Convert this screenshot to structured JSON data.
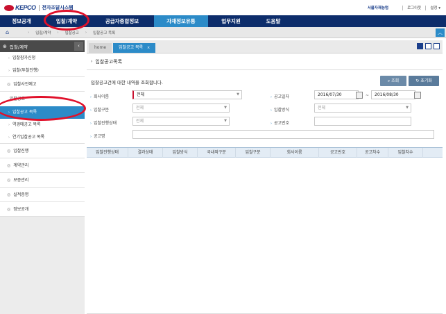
{
  "header": {
    "logo_brand": "KEPCO",
    "logo_system": "전자조달시스템",
    "user": "서울자재능텀",
    "logout": "로그아웃",
    "settings": "설정 ▾"
  },
  "mainnav": [
    {
      "label": "정보공개",
      "active": false
    },
    {
      "label": "입찰/계약",
      "active": false
    },
    {
      "label": "공급자종합정보",
      "active": false
    },
    {
      "label": "자재정보유통",
      "active": true
    },
    {
      "label": "업무지원",
      "active": false
    },
    {
      "label": "도움말",
      "active": false
    }
  ],
  "breadcrumb": {
    "items": [
      "입찰/계약",
      "입찰공고",
      "입찰공고 목록"
    ]
  },
  "sidebar": {
    "heading": "입찰/계약",
    "items": [
      {
        "label": "입찰참가신청",
        "type": "sub"
      },
      {
        "label": "입찰(투찰진행)",
        "type": "sub"
      },
      {
        "label": "입찰사전예고",
        "type": "item"
      },
      {
        "label": "입찰공고",
        "type": "item"
      },
      {
        "label": "입찰공고 목록",
        "type": "sub",
        "active": true
      },
      {
        "label": "역경매공고 목록",
        "type": "sub"
      },
      {
        "label": "연기입찰공고 목록",
        "type": "sub"
      },
      {
        "label": "입찰진행",
        "type": "item"
      },
      {
        "label": "계약관리",
        "type": "item"
      },
      {
        "label": "보증관리",
        "type": "item"
      },
      {
        "label": "실적증명",
        "type": "item"
      },
      {
        "label": "정보공개",
        "type": "item"
      }
    ]
  },
  "tabs": {
    "home": "home",
    "current": "입찰공고 목록"
  },
  "page": {
    "title": "입찰공고목록",
    "description": "입찰공고건에 대한 내역을 조회합니다.",
    "search_button": "조회",
    "reset_button": "초기화"
  },
  "form": {
    "company_label": "회사이름",
    "company_value": "전체",
    "date_label": "공고일자",
    "date_from": "2016/07/30",
    "date_sep": "~",
    "date_to": "2016/08/30",
    "bid_type_label": "입찰구분",
    "bid_type_value": "전체",
    "bid_method_label": "입찰방식",
    "bid_method_value": "전체",
    "bid_status_label": "입찰진행상태",
    "bid_status_value": "전체",
    "notice_no_label": "공고번호",
    "notice_no_value": "",
    "notice_name_label": "공고명",
    "notice_name_value": ""
  },
  "table": {
    "columns": [
      "입찰진행상태",
      "결과상태",
      "입찰방식",
      "국내외구분",
      "입찰구분",
      "회사이름",
      "공고번호",
      "공고차수",
      "입찰차수"
    ]
  }
}
